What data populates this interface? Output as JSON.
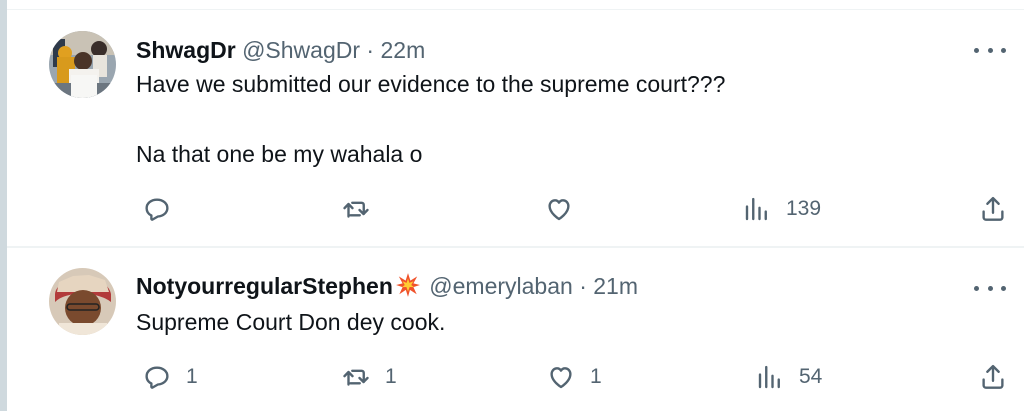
{
  "tweets": [
    {
      "name": "ShwagDr",
      "handle": "@ShwagDr",
      "separator": "·",
      "time": "22m",
      "text_lines": [
        "Have we submitted our evidence to the supreme court???",
        "Na that one be my wahala o"
      ],
      "actions": {
        "reply": "",
        "retweet": "",
        "like": "",
        "views": "139"
      }
    },
    {
      "name": "NotyourregularStephen",
      "emoji": "collision-emoji",
      "handle": "@emerylaban",
      "separator": "·",
      "time": "21m",
      "text_lines": [
        "Supreme Court Don dey cook."
      ],
      "actions": {
        "reply": "1",
        "retweet": "1",
        "like": "1",
        "views": "54"
      }
    }
  ],
  "icons": [
    "reply-icon",
    "retweet-icon",
    "like-icon",
    "views-icon",
    "share-icon",
    "more-icon"
  ],
  "colors": {
    "text": "#0f1419",
    "muted": "#536471",
    "divider": "#eff3f4",
    "rail": "#cfd9de"
  }
}
